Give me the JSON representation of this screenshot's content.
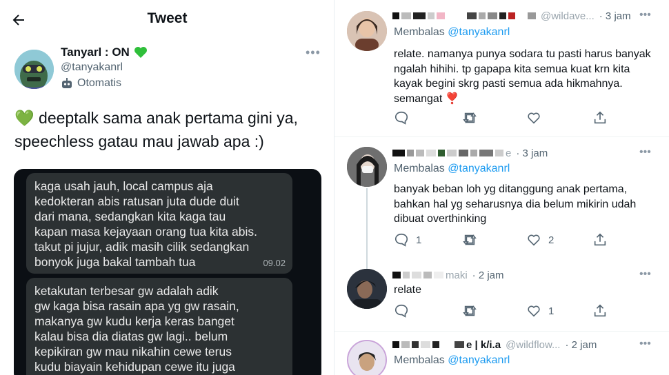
{
  "header": {
    "title": "Tweet"
  },
  "tweet": {
    "author_name": "Tanyarl : ON",
    "author_handle": "@tanyakanrl",
    "automated_label": "Otomatis",
    "text": "💚 deeptalk sama anak pertama gini ya, speechless gatau mau jawab apa :)",
    "chat_messages": [
      {
        "lines": [
          "kaga usah jauh, local campus aja",
          "kedokteran abis ratusan juta dude duit",
          "dari mana, sedangkan kita kaga tau",
          "kapan masa kejayaan orang tua kita abis.",
          "takut pi jujur, adik masih cilik sedangkan",
          "bonyok juga bakal tambah tua"
        ],
        "time": "09.02"
      },
      {
        "lines": [
          "ketakutan terbesar gw adalah adik",
          "gw kaga bisa rasain apa yg gw rasain,",
          "makanya gw kudu kerja keras banget",
          "kalau bisa dia diatas gw lagi.. belum",
          "kepikiran gw mau nikahin cewe terus",
          "kudu biayain kehidupan cewe itu juga"
        ],
        "time": ""
      }
    ]
  },
  "replies": [
    {
      "name_partial": "@wildave...",
      "time": "· 3 jam",
      "replying_prefix": "Membalas",
      "replying_to": "@tanyakanrl",
      "text": "relate. namanya punya sodara tu pasti harus banyak ngalah hihihi. tp gapapa kita semua kuat krn kita kayak begini skrg pasti semua ada hikmahnya. semangat ❣️",
      "reply_count": "",
      "like_count": ""
    },
    {
      "name_partial": "e",
      "time": "· 3 jam",
      "replying_prefix": "Membalas",
      "replying_to": "@tanyakanrl",
      "text": "banyak beban loh yg ditanggung anak pertama, bahkan hal yg seharusnya dia belum mikirin udah dibuat overthinking",
      "reply_count": "1",
      "like_count": "2"
    },
    {
      "name_partial": "maki",
      "time": "· 2 jam",
      "replying_prefix": "",
      "replying_to": "",
      "text": "relate",
      "reply_count": "",
      "like_count": "1"
    },
    {
      "name_partial": "e | k/i.a",
      "handle_partial": "@wildflow...",
      "time": "· 2 jam",
      "replying_prefix": "Membalas",
      "replying_to": "@tanyakanrl",
      "text": "",
      "reply_count": "",
      "like_count": ""
    }
  ],
  "colors": {
    "accent": "#1d9bf0",
    "text": "#0f1419",
    "secondary": "#536471",
    "heart": "#e0245e",
    "green_heart": "#2fbf3a"
  },
  "icons": {
    "back": "arrow-left-icon",
    "more": "more-horizontal-icon",
    "reply": "reply-icon",
    "retweet": "retweet-icon",
    "like": "heart-icon",
    "share": "share-icon",
    "bot": "robot-icon"
  }
}
